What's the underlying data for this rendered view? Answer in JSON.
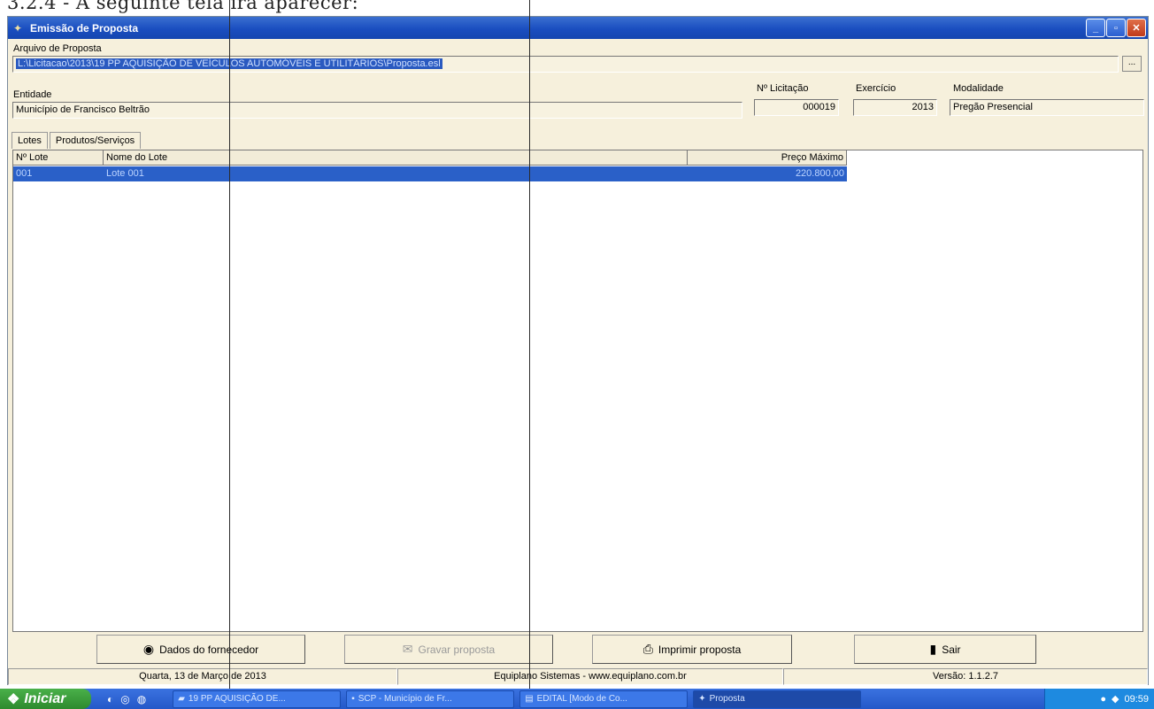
{
  "document_heading": "3.2.4 - A seguinte tela irá aparecer:",
  "window": {
    "title": "Emissão de Proposta",
    "app_icon": "proposal-app-icon",
    "controls": {
      "minimize": "_",
      "maximize": "▫",
      "close": "✕"
    }
  },
  "form": {
    "arquivo_label": "Arquivo de Proposta",
    "arquivo_value": "L:\\Licitacao\\2013\\19 PP AQUISIÇÃO DE VEÍCULOS AUTOMÓVEIS E UTILITÁRIOS\\Proposta.esl",
    "browse_label": "...",
    "entidade_label": "Entidade",
    "entidade_value": "Município de Francisco Beltrão",
    "licitacao_label": "Nº Licitação",
    "licitacao_value": "000019",
    "exercicio_label": "Exercício",
    "exercicio_value": "2013",
    "modalidade_label": "Modalidade",
    "modalidade_value": "Pregão Presencial"
  },
  "tabs": [
    {
      "label": "Lotes",
      "active": true
    },
    {
      "label": "Produtos/Serviços",
      "active": false
    }
  ],
  "grid": {
    "headers": [
      "Nº Lote",
      "Nome do Lote",
      "Preço Máximo"
    ],
    "rows": [
      {
        "numero": "001",
        "nome": "Lote 001",
        "preco": "220.800,00",
        "selected": true
      }
    ]
  },
  "buttons": {
    "dados": {
      "label": "Dados do fornecedor",
      "icon": "supplier-icon"
    },
    "gravar": {
      "label": "Gravar proposta",
      "icon": "save-icon",
      "disabled": true
    },
    "imprimir": {
      "label": "Imprimir proposta",
      "icon": "printer-icon"
    },
    "sair": {
      "label": "Sair",
      "icon": "exit-door-icon"
    }
  },
  "status": {
    "date": "Quarta, 13 de Março de 2013",
    "company": "Equiplano Sistemas - www.equiplano.com.br",
    "version": "Versão: 1.1.2.7"
  },
  "taskbar": {
    "start_label": "Iniciar",
    "items": [
      {
        "label": "19 PP AQUISIÇÃO DE...",
        "icon": "folder-icon"
      },
      {
        "label": "SCP - Município de Fr...",
        "icon": "app-icon"
      },
      {
        "label": "EDITAL [Modo de Co...",
        "icon": "word-icon"
      },
      {
        "label": "Proposta",
        "icon": "proposal-app-icon",
        "active": true
      }
    ],
    "clock": "09:59"
  },
  "colors": {
    "title_bar": "#1a4ec0",
    "selection": "#2a60c8",
    "window_bg": "#f6f0dc",
    "taskbar": "#2458c8",
    "start_button": "#2e8a2e"
  }
}
